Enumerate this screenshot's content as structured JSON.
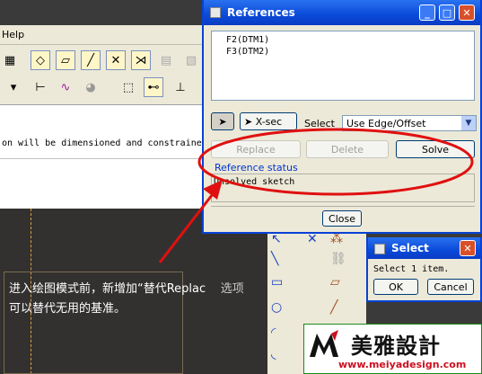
{
  "app": {
    "menu_fragment": "Help",
    "message_line": "on will be dimensioned and constraine",
    "note_line1": "进入绘图模式前，新增加“替代Replac",
    "note_line1_tail": "选项",
    "note_line2": "可以替代无用的基准。"
  },
  "references_dialog": {
    "title": "References",
    "list_items": [
      "F2(DTM1)",
      "F3(DTM2)"
    ],
    "pick_xsec_label": "X-sec",
    "select_label": "Select",
    "select_value": "Use Edge/Offset",
    "replace_label": "Replace",
    "delete_label": "Delete",
    "solve_label": "Solve",
    "status_heading": "Reference status",
    "status_text": "Unsolved sketch",
    "close_label": "Close"
  },
  "select_dialog": {
    "title": "Select",
    "message": "Select 1 item.",
    "ok_label": "OK",
    "cancel_label": "Cancel"
  },
  "logo": {
    "name_cn": "美雅設計",
    "url": "www.meiyadesign.com"
  },
  "colors": {
    "title_blue": "#0a4ad8",
    "annotation_red": "#e01010",
    "canvas_bg": "#333130"
  }
}
